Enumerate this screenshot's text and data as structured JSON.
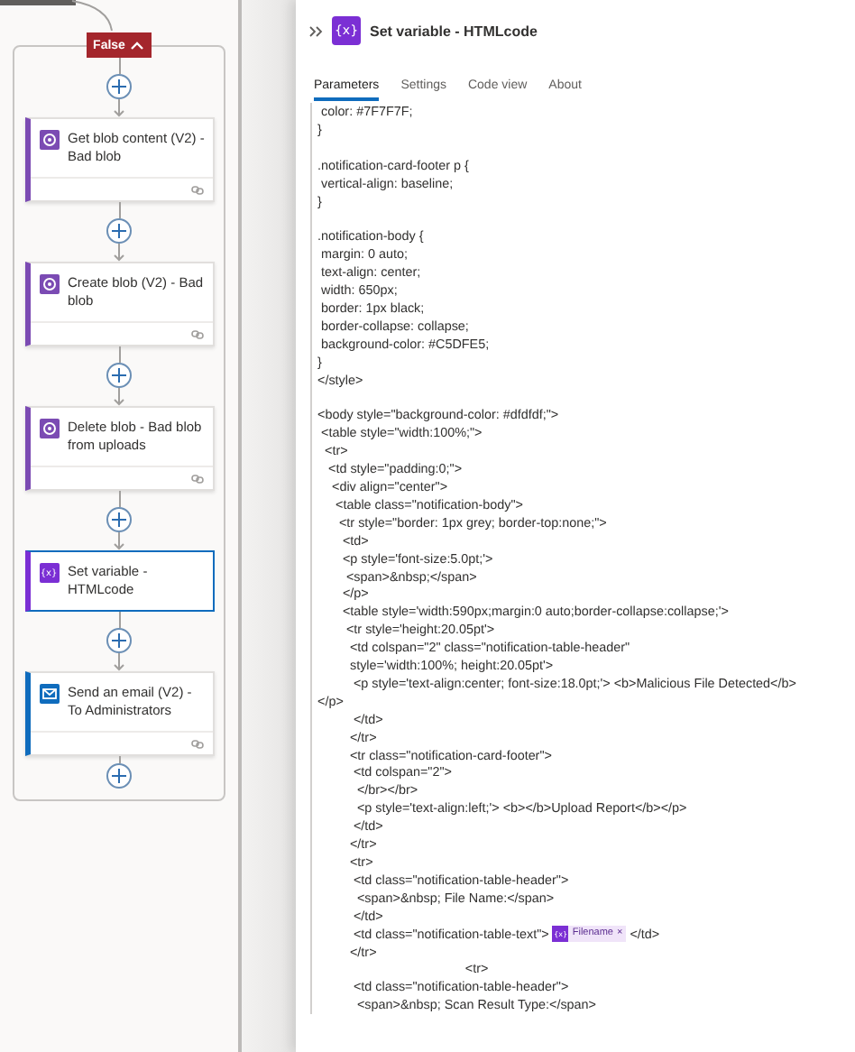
{
  "flow": {
    "branch": {
      "label": "False",
      "expanded": true
    },
    "cards": [
      {
        "title": "Get blob content (V2) - Bad blob",
        "kind": "blob",
        "color": "#7b4bb3",
        "selected": false,
        "footer": true
      },
      {
        "title": "Create blob (V2) - Bad blob",
        "kind": "blob",
        "color": "#7b4bb3",
        "selected": false,
        "footer": true
      },
      {
        "title": "Delete blob - Bad blob from uploads",
        "kind": "blob",
        "color": "#7b4bb3",
        "selected": false,
        "footer": true
      },
      {
        "title": "Set variable - HTMLcode",
        "kind": "variable",
        "icon_text": "{x}",
        "color": "#7b2fd4",
        "selected": true,
        "footer": false
      },
      {
        "title": "Send an email (V2) - To Administrators",
        "kind": "email",
        "color": "#0f6cbd",
        "selected": false,
        "footer": true
      }
    ]
  },
  "panel": {
    "icon_text": "{x}",
    "title": "Set variable - HTMLcode",
    "tabs": [
      {
        "label": "Parameters",
        "selected": true
      },
      {
        "label": "Settings",
        "selected": false
      },
      {
        "label": "Code view",
        "selected": false
      },
      {
        "label": "About",
        "selected": false
      }
    ],
    "code_lines": [
      {
        "kind": "text",
        "text": " color: #7F7F7F;"
      },
      {
        "kind": "text",
        "text": "}"
      },
      {
        "kind": "blank"
      },
      {
        "kind": "text",
        "text": ".notification-card-footer p {"
      },
      {
        "kind": "text",
        "text": " vertical-align: baseline;"
      },
      {
        "kind": "text",
        "text": "}"
      },
      {
        "kind": "blank"
      },
      {
        "kind": "text",
        "text": ".notification-body {"
      },
      {
        "kind": "text",
        "text": " margin: 0 auto;"
      },
      {
        "kind": "text",
        "text": " text-align: center;"
      },
      {
        "kind": "text",
        "text": " width: 650px;"
      },
      {
        "kind": "text",
        "text": " border: 1px black;"
      },
      {
        "kind": "text",
        "text": " border-collapse: collapse;"
      },
      {
        "kind": "text",
        "text": " background-color: #C5DFE5;"
      },
      {
        "kind": "text",
        "text": "}"
      },
      {
        "kind": "text",
        "text": "</style>"
      },
      {
        "kind": "blank"
      },
      {
        "kind": "text",
        "text": "<body style=\"background-color: #dfdfdf;\">"
      },
      {
        "kind": "text",
        "text": " <table style=\"width:100%;\">"
      },
      {
        "kind": "text",
        "text": "  <tr>"
      },
      {
        "kind": "text",
        "text": "   <td style=\"padding:0;\">"
      },
      {
        "kind": "text",
        "text": "    <div align=\"center\">"
      },
      {
        "kind": "text",
        "text": "     <table class=\"notification-body\">"
      },
      {
        "kind": "text",
        "text": "      <tr style=\"border: 1px grey; border-top:none;\">"
      },
      {
        "kind": "text",
        "text": "       <td>"
      },
      {
        "kind": "text",
        "text": "       <p style='font-size:5.0pt;'>"
      },
      {
        "kind": "text",
        "text": "        <span>&nbsp;</span>"
      },
      {
        "kind": "text",
        "text": "       </p>"
      },
      {
        "kind": "text",
        "text": "       <table style='width:590px;margin:0 auto;border-collapse:collapse;'>"
      },
      {
        "kind": "text",
        "text": "        <tr style='height:20.05pt'>"
      },
      {
        "kind": "text",
        "text": "         <td colspan=\"2\" class=\"notification-table-header\""
      },
      {
        "kind": "text",
        "text": "         style='width:100%; height:20.05pt'>"
      },
      {
        "kind": "text",
        "text": "          <p style='text-align:center; font-size:18.0pt;'> <b>Malicious File Detected</b>"
      },
      {
        "kind": "text",
        "text": "</p>"
      },
      {
        "kind": "text",
        "text": "          </td>"
      },
      {
        "kind": "text",
        "text": "         </tr>"
      },
      {
        "kind": "text",
        "text": "         <tr class=\"notification-card-footer\">"
      },
      {
        "kind": "text",
        "text": "          <td colspan=\"2\">"
      },
      {
        "kind": "text",
        "text": "           </br></br>"
      },
      {
        "kind": "text",
        "text": "           <p style='text-align:left;'> <b></b>Upload Report</b></p>"
      },
      {
        "kind": "text",
        "text": "          </td>"
      },
      {
        "kind": "text",
        "text": "         </tr>"
      },
      {
        "kind": "text",
        "text": "         <tr>"
      },
      {
        "kind": "text",
        "text": "          <td class=\"notification-table-header\">"
      },
      {
        "kind": "text",
        "text": "           <span>&nbsp; File Name:</span>"
      },
      {
        "kind": "text",
        "text": "          </td>"
      },
      {
        "kind": "token",
        "before": "          <td class=\"notification-table-text\"> ",
        "token": {
          "icon_text": "{x}",
          "label": "Filename",
          "close": "×"
        },
        "after": " </td>"
      },
      {
        "kind": "text",
        "text": "         </tr>"
      },
      {
        "kind": "text",
        "text": "                                         <tr>"
      },
      {
        "kind": "text",
        "text": "          <td class=\"notification-table-header\">"
      },
      {
        "kind": "text",
        "text": "           <span>&nbsp; Scan Result Type:</span>"
      }
    ]
  }
}
